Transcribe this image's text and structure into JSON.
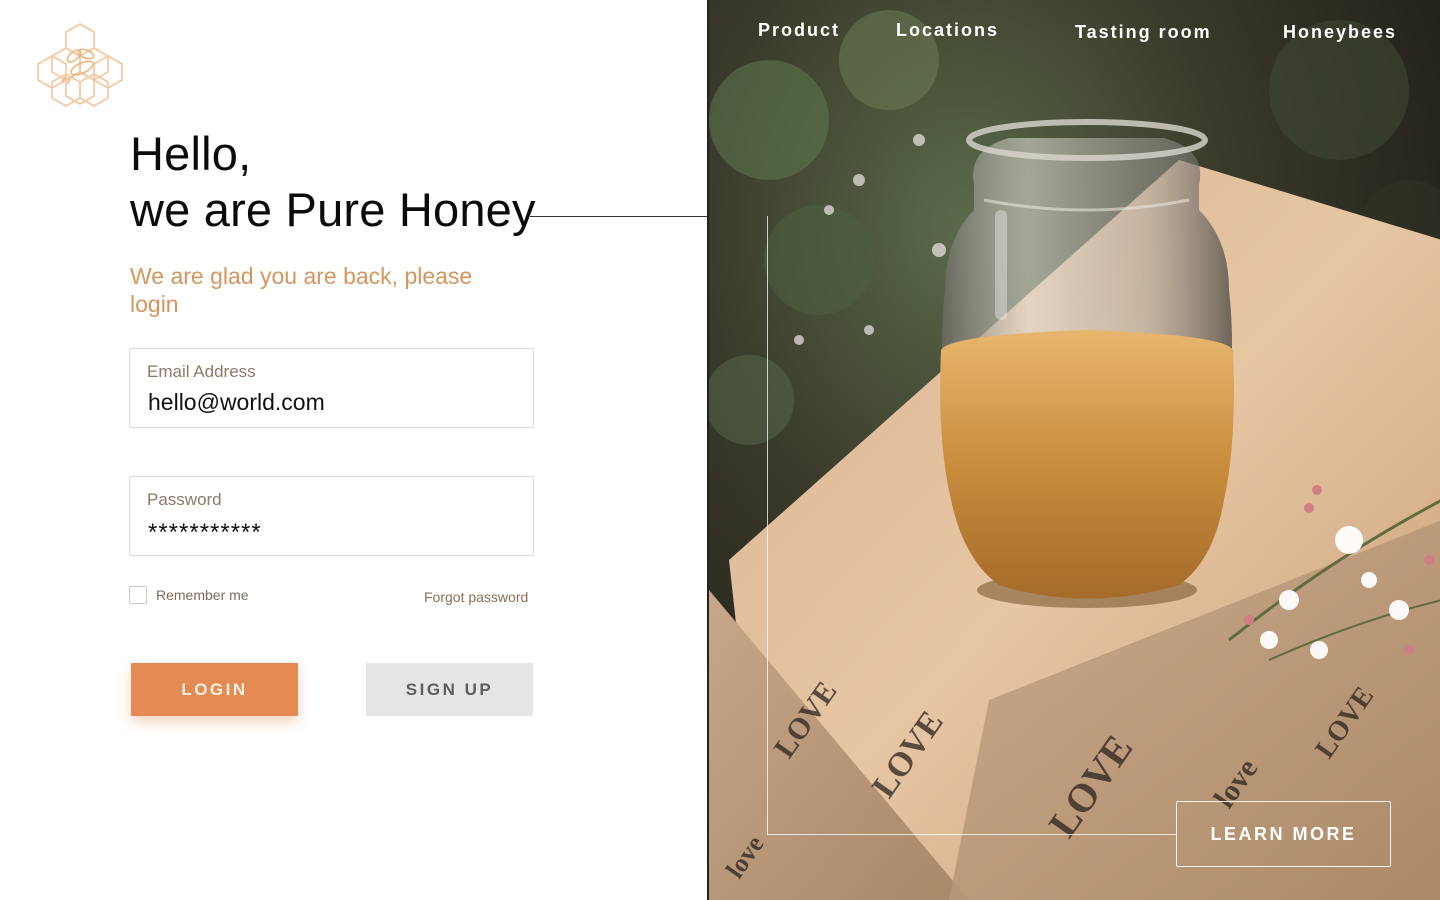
{
  "brand": {
    "logo_icon": "honeycomb-bee-icon",
    "accent_color": "#e58a52",
    "subheading_color": "#d4955e"
  },
  "hero": {
    "heading_line1": "Hello,",
    "heading_line2": "we are Pure Honey",
    "subheading": "We are glad you are back, please login"
  },
  "form": {
    "email_label": "Email Address",
    "email_value": "hello@world.com",
    "password_label": "Password",
    "password_value": "***********",
    "remember_label": "Remember me",
    "remember_checked": false,
    "forgot_label": "Forgot password",
    "login_label": "LOGIN",
    "signup_label": "SIGN UP"
  },
  "nav": {
    "items": [
      {
        "label": "Product"
      },
      {
        "label": "Locations"
      },
      {
        "label": "Tasting room"
      },
      {
        "label": "Honeybees"
      }
    ]
  },
  "cta": {
    "learn_more_label": "LEARN MORE"
  }
}
